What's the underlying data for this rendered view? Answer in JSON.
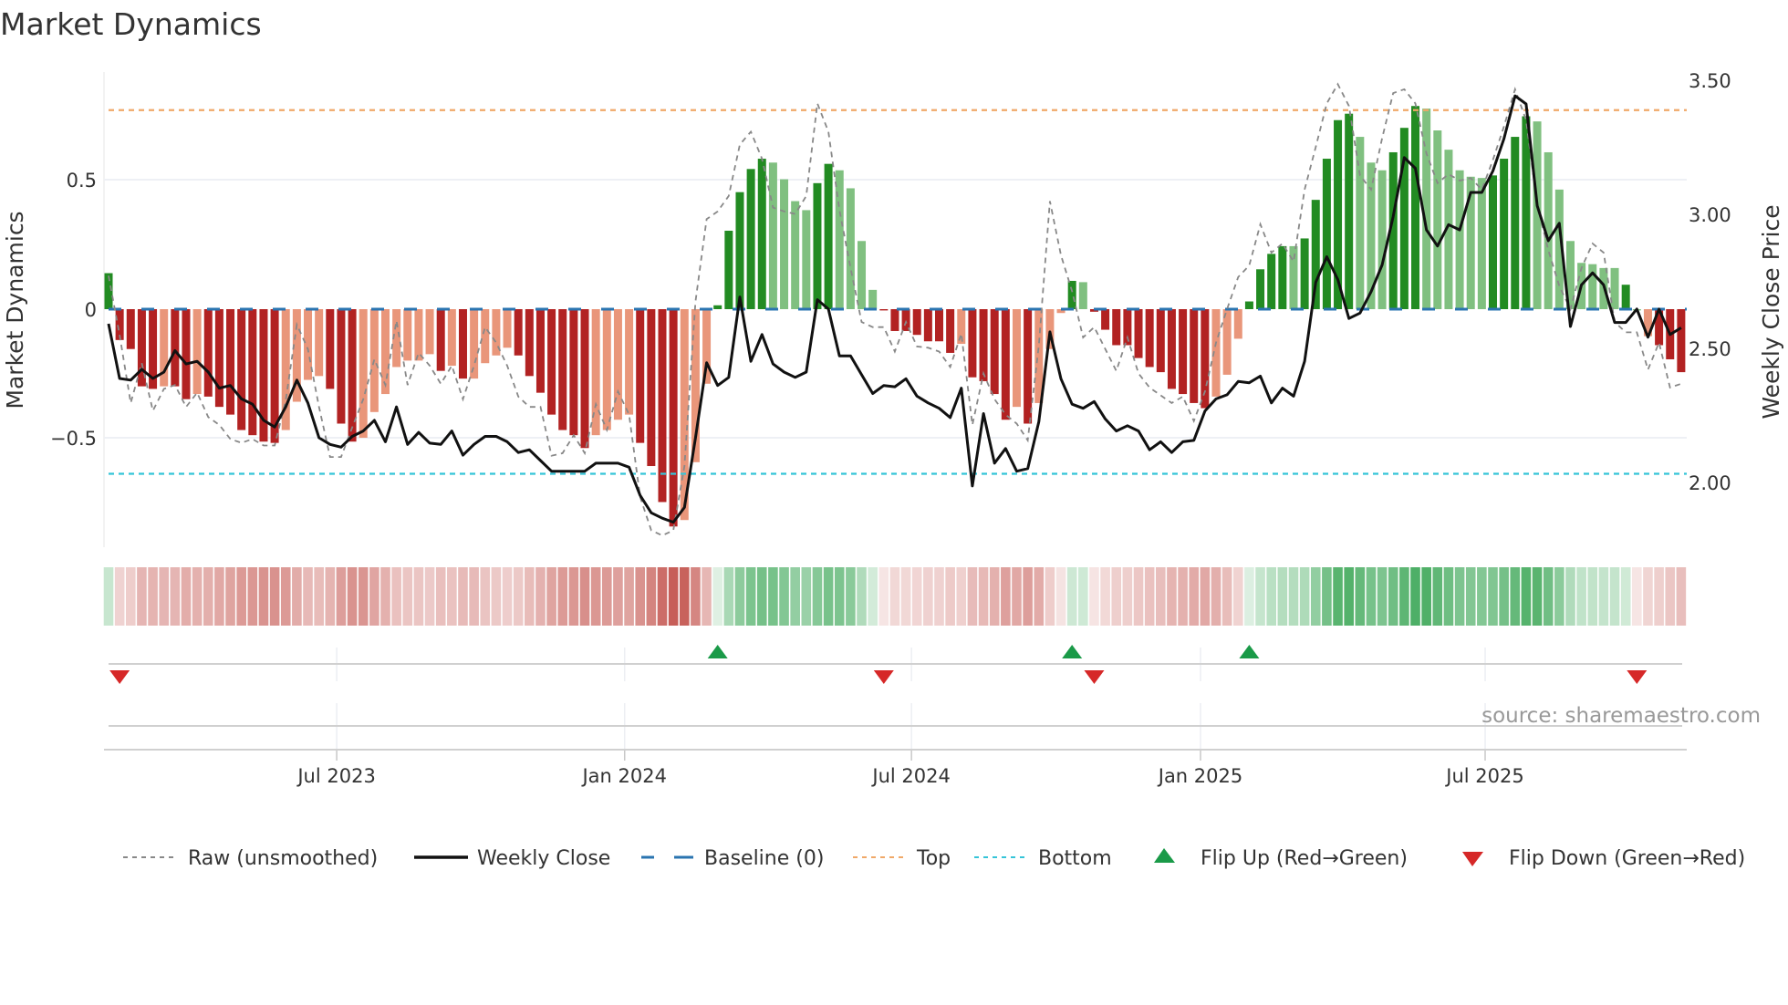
{
  "chart_data": {
    "type": "bar",
    "title": "Market Dynamics",
    "ylabel": "Market Dynamics",
    "y2label": "Weekly Close Price",
    "ylim": [
      -0.93,
      0.92
    ],
    "y2lim": [
      1.8,
      3.6
    ],
    "yticks": [
      "0.5",
      "0",
      "−0.5"
    ],
    "y2ticks": [
      "3.50",
      "3.00",
      "2.50",
      "2.00"
    ],
    "xticks": [
      {
        "label": "Jul 2023",
        "week_index": 20.6
      },
      {
        "label": "Jan 2024",
        "week_index": 46.6
      },
      {
        "label": "Jul 2024",
        "week_index": 72.5
      },
      {
        "label": "Jan 2025",
        "week_index": 98.6
      },
      {
        "label": "Jul 2025",
        "week_index": 124.3
      }
    ],
    "top_level": 0.774,
    "bottom_level": -0.64,
    "baseline": 0,
    "values": [
      0.14,
      -0.12,
      -0.155,
      -0.3,
      -0.31,
      -0.3,
      -0.3,
      -0.35,
      -0.33,
      -0.34,
      -0.38,
      -0.41,
      -0.47,
      -0.49,
      -0.515,
      -0.52,
      -0.47,
      -0.36,
      -0.275,
      -0.26,
      -0.31,
      -0.445,
      -0.515,
      -0.5,
      -0.4,
      -0.33,
      -0.225,
      -0.2,
      -0.2,
      -0.175,
      -0.24,
      -0.22,
      -0.27,
      -0.27,
      -0.21,
      -0.18,
      -0.15,
      -0.18,
      -0.26,
      -0.325,
      -0.41,
      -0.47,
      -0.49,
      -0.54,
      -0.49,
      -0.47,
      -0.43,
      -0.41,
      -0.52,
      -0.61,
      -0.75,
      -0.845,
      -0.82,
      -0.595,
      -0.29,
      0.015,
      0.305,
      0.455,
      0.545,
      0.585,
      0.57,
      0.505,
      0.42,
      0.385,
      0.49,
      0.565,
      0.54,
      0.47,
      0.265,
      0.075,
      -0.005,
      -0.085,
      -0.085,
      -0.1,
      -0.125,
      -0.125,
      -0.17,
      -0.135,
      -0.265,
      -0.28,
      -0.33,
      -0.43,
      -0.38,
      -0.445,
      -0.365,
      -0.155,
      -0.015,
      0.11,
      0.105,
      -0.01,
      -0.08,
      -0.14,
      -0.14,
      -0.19,
      -0.225,
      -0.245,
      -0.31,
      -0.33,
      -0.365,
      -0.385,
      -0.34,
      -0.255,
      -0.115,
      0.03,
      0.155,
      0.215,
      0.245,
      0.245,
      0.275,
      0.425,
      0.585,
      0.735,
      0.76,
      0.67,
      0.57,
      0.54,
      0.61,
      0.705,
      0.79,
      0.78,
      0.695,
      0.62,
      0.54,
      0.515,
      0.51,
      0.52,
      0.585,
      0.67,
      0.75,
      0.73,
      0.61,
      0.465,
      0.265,
      0.18,
      0.175,
      0.16,
      0.16,
      0.095,
      -0.005,
      -0.105,
      -0.14,
      -0.195,
      -0.245
    ],
    "bar_shade": "GDDDDLDDLDDDDDDDLLLLDDDLLLLLLLDLDLLLLDDDDDDDLLLLDDDDLLLGGGGGggggGGggggDDDDDDDLDDDDLDLLLGgDDDDDDDDDDDLLLGGGGgGGGGGgggGGGggggggGGGGggggggggGgLDDDD",
    "raw": [
      0.13,
      -0.1,
      -0.365,
      -0.21,
      -0.395,
      -0.31,
      -0.295,
      -0.38,
      -0.325,
      -0.42,
      -0.45,
      -0.505,
      -0.52,
      -0.505,
      -0.53,
      -0.53,
      -0.355,
      -0.06,
      -0.155,
      -0.38,
      -0.575,
      -0.575,
      -0.46,
      -0.35,
      -0.195,
      -0.295,
      -0.045,
      -0.295,
      -0.17,
      -0.22,
      -0.29,
      -0.22,
      -0.35,
      -0.22,
      -0.07,
      -0.13,
      -0.22,
      -0.34,
      -0.38,
      -0.38,
      -0.57,
      -0.56,
      -0.49,
      -0.56,
      -0.37,
      -0.47,
      -0.32,
      -0.41,
      -0.73,
      -0.86,
      -0.88,
      -0.86,
      -0.61,
      0.03,
      0.35,
      0.38,
      0.44,
      0.64,
      0.69,
      0.585,
      0.395,
      0.38,
      0.37,
      0.44,
      0.8,
      0.69,
      0.385,
      0.16,
      -0.05,
      -0.07,
      -0.07,
      -0.165,
      -0.05,
      -0.145,
      -0.15,
      -0.165,
      -0.225,
      -0.095,
      -0.45,
      -0.25,
      -0.35,
      -0.41,
      -0.445,
      -0.51,
      -0.14,
      0.42,
      0.21,
      0.07,
      -0.11,
      -0.07,
      -0.155,
      -0.24,
      -0.11,
      -0.25,
      -0.305,
      -0.335,
      -0.365,
      -0.34,
      -0.435,
      -0.32,
      -0.13,
      0,
      0.125,
      0.17,
      0.33,
      0.22,
      0.255,
      0.185,
      0.465,
      0.63,
      0.8,
      0.875,
      0.79,
      0.52,
      0.465,
      0.665,
      0.84,
      0.855,
      0.8,
      0.605,
      0.49,
      0.525,
      0.5,
      0.51,
      0.465,
      0.58,
      0.71,
      0.855,
      0.735,
      0.405,
      0.23,
      0.09,
      0,
      0.16,
      0.255,
      0.22,
      -0.05,
      -0.09,
      -0.09,
      -0.235,
      -0.13,
      -0.305,
      -0.29
    ],
    "weekly_close": [
      2.59,
      2.386,
      2.38,
      2.42,
      2.386,
      2.41,
      2.49,
      2.44,
      2.45,
      2.41,
      2.35,
      2.36,
      2.31,
      2.29,
      2.23,
      2.205,
      2.28,
      2.38,
      2.295,
      2.165,
      2.14,
      2.13,
      2.17,
      2.19,
      2.23,
      2.15,
      2.28,
      2.14,
      2.185,
      2.145,
      2.14,
      2.19,
      2.1,
      2.14,
      2.17,
      2.17,
      2.15,
      2.11,
      2.12,
      2.08,
      2.04,
      2.04,
      2.04,
      2.04,
      2.07,
      2.07,
      2.07,
      2.055,
      1.95,
      1.885,
      1.865,
      1.85,
      1.905,
      2.165,
      2.445,
      2.36,
      2.39,
      2.69,
      2.45,
      2.55,
      2.44,
      2.41,
      2.39,
      2.41,
      2.68,
      2.645,
      2.47,
      2.47,
      2.4,
      2.33,
      2.36,
      2.355,
      2.385,
      2.32,
      2.295,
      2.275,
      2.24,
      2.35,
      1.985,
      2.255,
      2.07,
      2.125,
      2.04,
      2.05,
      2.225,
      2.56,
      2.385,
      2.29,
      2.275,
      2.3,
      2.235,
      2.19,
      2.21,
      2.19,
      2.12,
      2.15,
      2.11,
      2.15,
      2.155,
      2.265,
      2.31,
      2.325,
      2.375,
      2.37,
      2.395,
      2.295,
      2.35,
      2.32,
      2.45,
      2.745,
      2.84,
      2.755,
      2.61,
      2.63,
      2.71,
      2.81,
      2.99,
      3.21,
      3.17,
      2.94,
      2.88,
      2.96,
      2.94,
      3.08,
      3.08,
      3.16,
      3.28,
      3.44,
      3.41,
      3.03,
      2.9,
      2.965,
      2.58,
      2.735,
      2.78,
      2.735,
      2.595,
      2.595,
      2.645,
      2.54,
      2.645,
      2.55,
      2.575
    ],
    "flip_up_weeks": [
      55,
      87,
      103
    ],
    "flip_down_weeks": [
      1,
      70,
      89,
      138
    ],
    "legend_position": "bottom",
    "legend": {
      "raw": "Raw (unsmoothed)",
      "close": "Weekly Close",
      "baseline": "Baseline (0)",
      "top": "Top",
      "bottom": "Bottom",
      "flip_up": "Flip Up (Red→Green)",
      "flip_down": "Flip Down (Green→Red)"
    },
    "source": "source: sharemaestro.com"
  },
  "colors": {
    "strong_red": "#b22222",
    "weak_red": "#e9967a",
    "strong_green": "#228b22",
    "weak_green": "#80c080",
    "top": "#f0a868",
    "bottom": "#35c4d8",
    "baseline": "#2a74b0",
    "raw": "#888888",
    "close": "#111111",
    "flip_up": "#1a9a48",
    "flip_down": "#d62828"
  }
}
